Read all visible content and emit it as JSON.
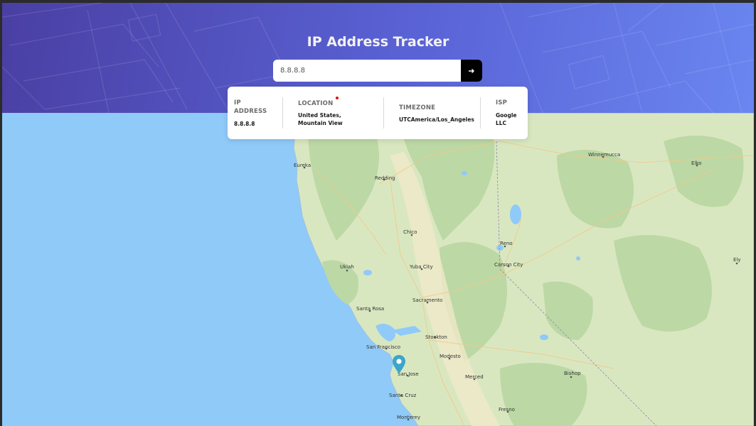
{
  "app": {
    "title": "IP Address Tracker"
  },
  "search": {
    "value": "8.8.8.8",
    "placeholder": "8.8.8.8",
    "button_icon": "arrow-right-icon"
  },
  "info": {
    "ip": {
      "label": "IP ADDRESS",
      "value": "8.8.8.8"
    },
    "location": {
      "label": "LOCATION",
      "value": "United States, Mountain View"
    },
    "timezone": {
      "label": "TIMEZONE",
      "value": "UTCAmerica/Los_Angeles"
    },
    "isp": {
      "label": "ISP",
      "value": "Google LLC"
    }
  },
  "map": {
    "marker_icon": "map-pin-icon",
    "cities": [
      "Eureka",
      "Redding",
      "Chico",
      "Ukiah",
      "Yuba City",
      "Sacramento",
      "Santa Rosa",
      "Stockton",
      "San Francisco",
      "Modesto",
      "San Jose",
      "Merced",
      "Santa Cruz",
      "Monterey",
      "Fresno",
      "Reno",
      "Carson City",
      "Winnemucca",
      "Elko",
      "Ely",
      "Bishop"
    ]
  },
  "colors": {
    "header_start": "#4a3fa3",
    "header_end": "#6a86f0",
    "ocean": "#8fcaf9",
    "land": "#d9e7c1",
    "forest": "#bcd8a5",
    "button": "#000000",
    "marker": "#3ba6c9",
    "indicator": "#e01010"
  }
}
